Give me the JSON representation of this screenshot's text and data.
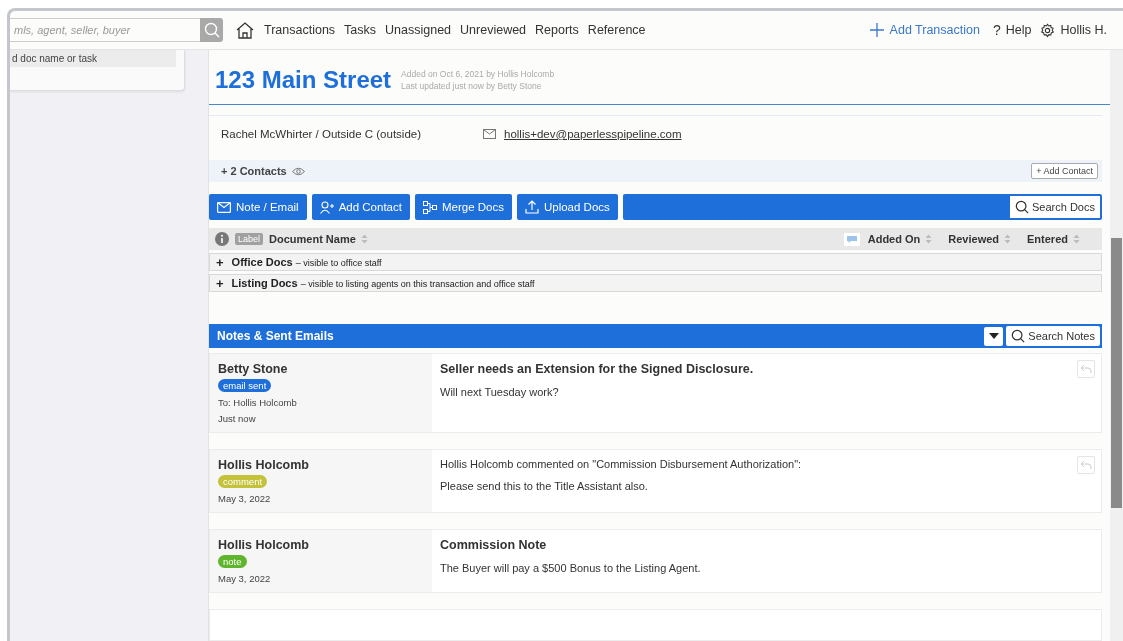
{
  "search": {
    "value": "mls, agent, seller, buyer"
  },
  "nav": {
    "links": [
      {
        "label": "Transactions"
      },
      {
        "label": "Tasks"
      },
      {
        "label": "Unassigned"
      },
      {
        "label": "Unreviewed"
      },
      {
        "label": "Reports"
      },
      {
        "label": "Reference"
      }
    ],
    "add_transaction": "Add Transaction",
    "help_mark": "?",
    "help": "Help",
    "user": "Hollis H."
  },
  "dropdown": {
    "items": [
      "d doc name or task"
    ]
  },
  "transaction": {
    "title": "123 Main Street",
    "added": "Added on Oct 6, 2021 by Hollis Holcomb",
    "updated": "Last updated just now by Betty Stone"
  },
  "contact": {
    "name": "Rachel McWhirter / Outside C (outside)",
    "email": "hollis+dev@paperlesspipeline.com"
  },
  "contacts_bar": {
    "label": "+ 2 Contacts",
    "add_button": "+ Add Contact"
  },
  "toolbar": {
    "buttons": [
      {
        "label": "Note / Email",
        "kind": "mail"
      },
      {
        "label": "Add Contact",
        "kind": "person"
      },
      {
        "label": "Merge Docs",
        "kind": "merge"
      },
      {
        "label": "Upload Docs",
        "kind": "upload"
      }
    ],
    "search": "Search Docs"
  },
  "docs_table": {
    "label_tag": "Label",
    "columns": [
      "Document Name",
      "Added On",
      "Reviewed",
      "Entered"
    ],
    "groups": [
      {
        "toggle": "+",
        "name": "Office Docs",
        "note": "– visible to office staff"
      },
      {
        "toggle": "+",
        "name": "Listing Docs",
        "note": "– visible to listing agents on this transaction and office staff"
      }
    ]
  },
  "notes": {
    "title": "Notes & Sent Emails",
    "search": "Search Notes",
    "items": [
      {
        "author": "Betty Stone",
        "badge": "email sent",
        "color": "#1e6fd9",
        "meta": [
          "To: Hollis Holcomb",
          "Just now"
        ],
        "kind": "email",
        "title": "Seller needs an Extension for the Signed Disclosure.",
        "body": "Will next Tuesday work?",
        "reply": true
      },
      {
        "author": "Hollis Holcomb",
        "badge": "comment",
        "color": "#c3c23a",
        "meta": [
          "May 3, 2022"
        ],
        "kind": "comment",
        "title": "Hollis Holcomb commented on \"Commission Disbursement Authorization\":",
        "body": "Please send this to the Title Assistant also.",
        "reply": true
      },
      {
        "author": "Hollis Holcomb",
        "badge": "note",
        "color": "#5fb52b",
        "meta": [
          "May 3, 2022"
        ],
        "kind": "note",
        "title": "Commission Note",
        "body": "The Buyer will pay a $500 Bonus to the Listing Agent.",
        "reply": false
      }
    ]
  }
}
